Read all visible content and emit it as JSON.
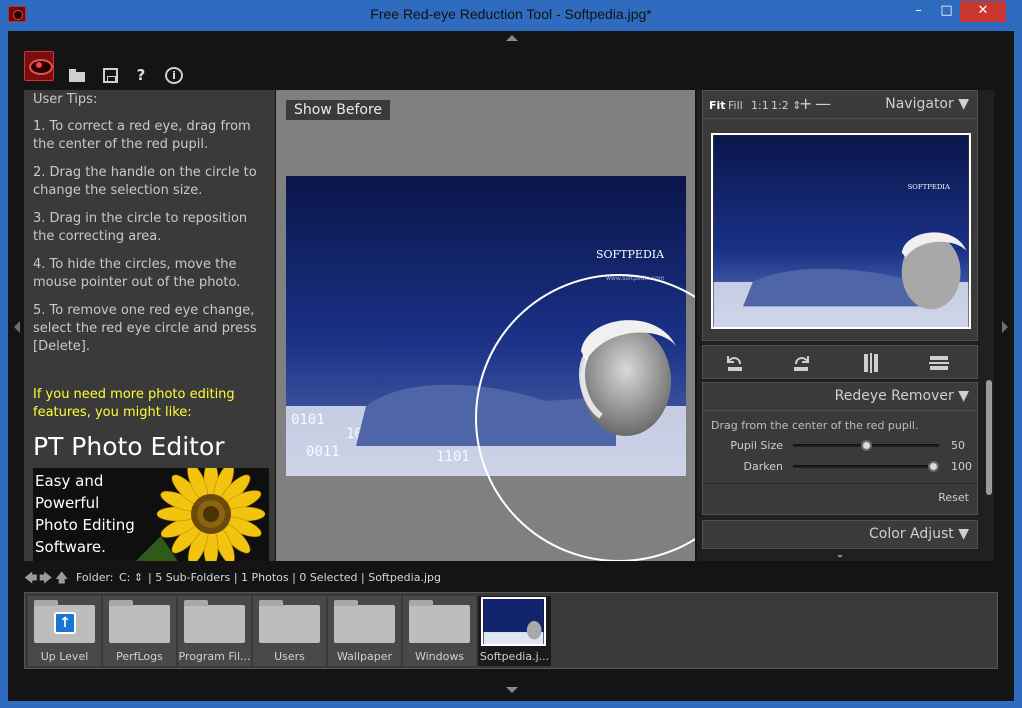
{
  "window": {
    "title": "Free Red-eye Reduction Tool - Softpedia.jpg*",
    "minimize": "–",
    "maximize": "□",
    "close": "✕"
  },
  "toolbar": {
    "icons": [
      "app-logo-icon",
      "folder-icon",
      "save-icon",
      "help-icon",
      "info-icon"
    ],
    "help_glyph": "?",
    "info_glyph": "i"
  },
  "tips": {
    "title": "User Tips:",
    "items": [
      "1. To correct a red eye, drag from the center of the red pupil.",
      "2. Drag the handle on the circle to change the selection size.",
      "3. Drag in the circle to reposition the correcting area.",
      "4. To hide the circles, move the mouse pointer out of the photo.",
      "5. To remove one red eye change, select the red eye circle and press [Delete]."
    ],
    "promo": "If you need more photo editing features, you might like:",
    "product_title": "PT Photo Editor",
    "ad_text": "Easy and Powerful Photo Editing Software."
  },
  "canvas": {
    "show_before_label": "Show Before",
    "watermark": "SOFTPEDIA",
    "watermark_sub": "www.softpedia.com"
  },
  "navigator": {
    "zoom_options": [
      "Fit",
      "Fill",
      "1:1",
      "1:2 ⇕"
    ],
    "zoom_in": "+",
    "zoom_out": "—",
    "title": "Navigator",
    "chevron": "▼"
  },
  "redeye": {
    "title": "Redeye Remover",
    "chevron": "▼",
    "instruction": "Drag from the center of the red pupil.",
    "pupil_label": "Pupil Size",
    "pupil_value": "50",
    "pupil_fraction": 0.5,
    "darken_label": "Darken",
    "darken_value": "100",
    "darken_fraction": 1.0,
    "reset": "Reset"
  },
  "color_adjust": {
    "title": "Color Adjust",
    "chevron": "▼"
  },
  "pathbar": {
    "back": "🡄",
    "forward": "🡆",
    "up": "🡅",
    "label": "Folder:",
    "drive": "C: ⇕",
    "info": "| 5 Sub-Folders | 1 Photos | 0 Selected | Softpedia.jpg"
  },
  "browser": {
    "items": [
      {
        "label": "Up Level",
        "type": "up"
      },
      {
        "label": "PerfLogs",
        "type": "folder"
      },
      {
        "label": "Program Fil...",
        "type": "folder"
      },
      {
        "label": "Users",
        "type": "folder"
      },
      {
        "label": "Wallpaper",
        "type": "folder"
      },
      {
        "label": "Windows",
        "type": "folder"
      },
      {
        "label": "Softpedia.j...",
        "type": "photo"
      }
    ]
  },
  "colors": {
    "titlebar": "#2f6cbf",
    "close": "#c7372f",
    "promo_text": "#ffff33",
    "photo_bg": "#0d1b5c"
  }
}
